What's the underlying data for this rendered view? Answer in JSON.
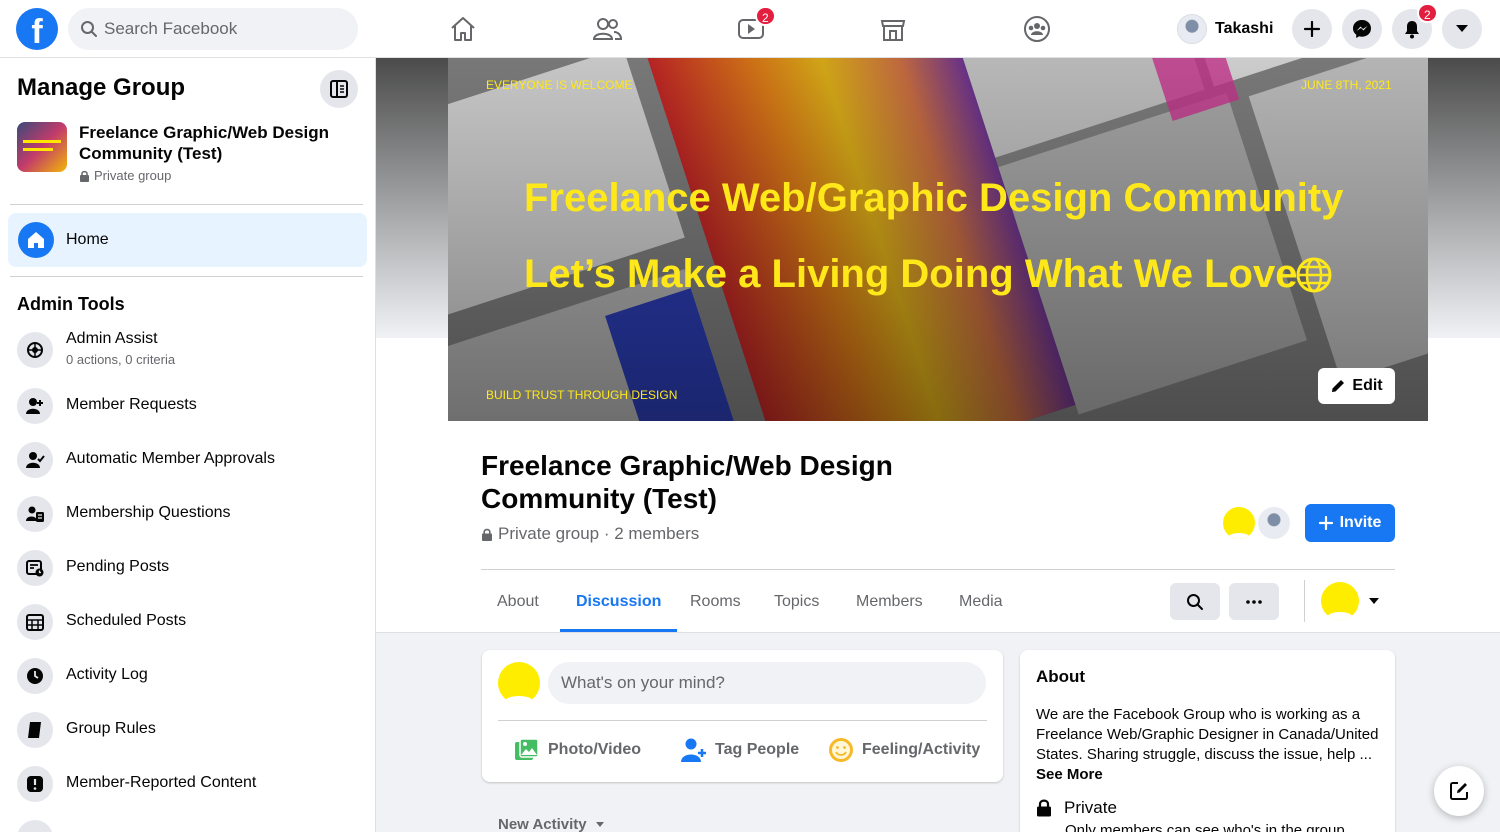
{
  "colors": {
    "brand": "#1877f2",
    "badge": "#e41e3f",
    "cover_text": "#ffe81a",
    "avatar_yellow": "#ffed00"
  },
  "search": {
    "placeholder": "Search Facebook"
  },
  "nav": {
    "icons": [
      "home-icon",
      "friends-icon",
      "watch-icon",
      "marketplace-icon",
      "groups-icon"
    ],
    "watch_badge": "2",
    "user_name": "Takashi",
    "notifications_badge": "2"
  },
  "sidebar": {
    "title": "Manage Group",
    "group_name": "Freelance Graphic/Web Design Community (Test)",
    "group_privacy": "Private group",
    "home_label": "Home",
    "admin_tools_heading": "Admin Tools",
    "tools": [
      {
        "label": "Admin Assist",
        "sub": "0 actions, 0 criteria",
        "icon": "admin-assist-icon"
      },
      {
        "label": "Member Requests",
        "icon": "member-requests-icon"
      },
      {
        "label": "Automatic Member Approvals",
        "icon": "auto-approvals-icon"
      },
      {
        "label": "Membership Questions",
        "icon": "membership-questions-icon"
      },
      {
        "label": "Pending Posts",
        "icon": "pending-posts-icon"
      },
      {
        "label": "Scheduled Posts",
        "icon": "scheduled-posts-icon"
      },
      {
        "label": "Activity Log",
        "icon": "activity-log-icon"
      },
      {
        "label": "Group Rules",
        "icon": "group-rules-icon"
      },
      {
        "label": "Member-Reported Content",
        "icon": "reported-content-icon"
      }
    ]
  },
  "cover": {
    "top_left": "EVERYONE IS WELCOME",
    "top_right": "JUNE 8TH, 2021",
    "headline1": "Freelance Web/Graphic Design Community",
    "headline2": "Let’s Make a Living Doing What We Love",
    "bottom_left": "BUILD TRUST THROUGH DESIGN",
    "edit_label": "Edit"
  },
  "group": {
    "title": "Freelance Graphic/Web Design Community (Test)",
    "meta": "Private group · 2 members",
    "invite_label": "Invite"
  },
  "tabs": [
    {
      "label": "About",
      "active": false
    },
    {
      "label": "Discussion",
      "active": true
    },
    {
      "label": "Rooms",
      "active": false
    },
    {
      "label": "Topics",
      "active": false
    },
    {
      "label": "Members",
      "active": false
    },
    {
      "label": "Media",
      "active": false
    }
  ],
  "composer": {
    "placeholder": "What's on your mind?",
    "actions": [
      "Photo/Video",
      "Tag People",
      "Feeling/Activity"
    ]
  },
  "feed": {
    "sort_label": "New Activity"
  },
  "about": {
    "heading": "About",
    "description": "We are the Facebook Group who is working as a Freelance Web/Graphic Designer in Canada/United States. Sharing struggle, discuss the issue, help ...",
    "see_more": "See More",
    "privacy_title": "Private",
    "privacy_sub": "Only members can see who's in the group"
  }
}
